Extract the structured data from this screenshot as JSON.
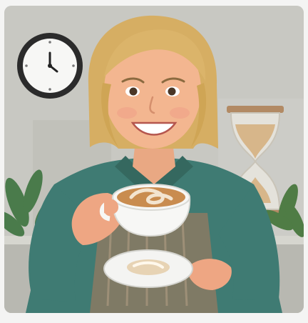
{
  "image": {
    "subject": "woman-holding-latte",
    "palette": {
      "background": "#c9c9c3",
      "shirt": "#3f7b73",
      "hair": "#d8b36a",
      "skin": "#f0b18c",
      "cup": "#f7f7f5",
      "coffee": "#c98c4f"
    }
  }
}
